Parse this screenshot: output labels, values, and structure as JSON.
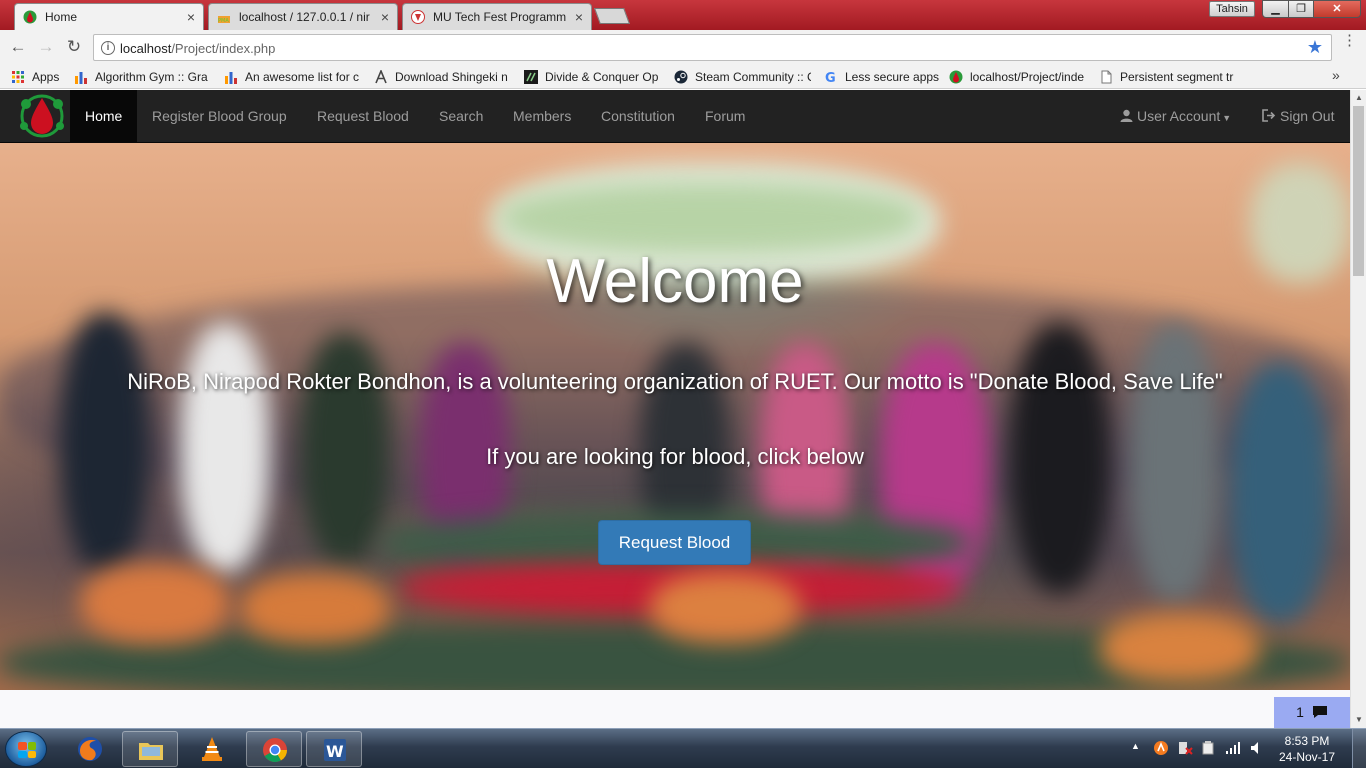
{
  "browser": {
    "tabs": [
      {
        "title": "Home",
        "close": "×"
      },
      {
        "title": "localhost / 127.0.0.1 / nir",
        "close": "×"
      },
      {
        "title": "MU Tech Fest Programm",
        "close": "×"
      }
    ],
    "profile_name": "Tahsin",
    "url_host": "localhost",
    "url_path": "/Project/index.php",
    "bookmarks": [
      "Apps",
      "Algorithm Gym :: Gra",
      "An awesome list for c",
      "Download Shingeki n",
      "Divide & Conquer Op",
      "Steam Community :: C",
      "Less secure apps",
      "localhost/Project/inde",
      "Persistent segment tr"
    ],
    "more_bookmarks": "»"
  },
  "site": {
    "nav": {
      "items": [
        "Home",
        "Register Blood Group",
        "Request Blood",
        "Search",
        "Members",
        "Constitution",
        "Forum"
      ],
      "user_account": "User Account",
      "sign_out": "Sign Out"
    },
    "hero": {
      "heading": "Welcome",
      "tagline": "NiRoB, Nirapod Rokter Bondhon, is a volunteering organization of RUET. Our motto is \"Donate Blood, Save Life\"",
      "subline": "If you are looking for blood, click below",
      "button": "Request Blood"
    },
    "chat_count": "1"
  },
  "taskbar": {
    "time": "8:53 PM",
    "date": "24-Nov-17"
  },
  "colors": {
    "navbar": "#222222",
    "primary_button": "#337ab7",
    "chrome_frame": "#b3232b"
  }
}
